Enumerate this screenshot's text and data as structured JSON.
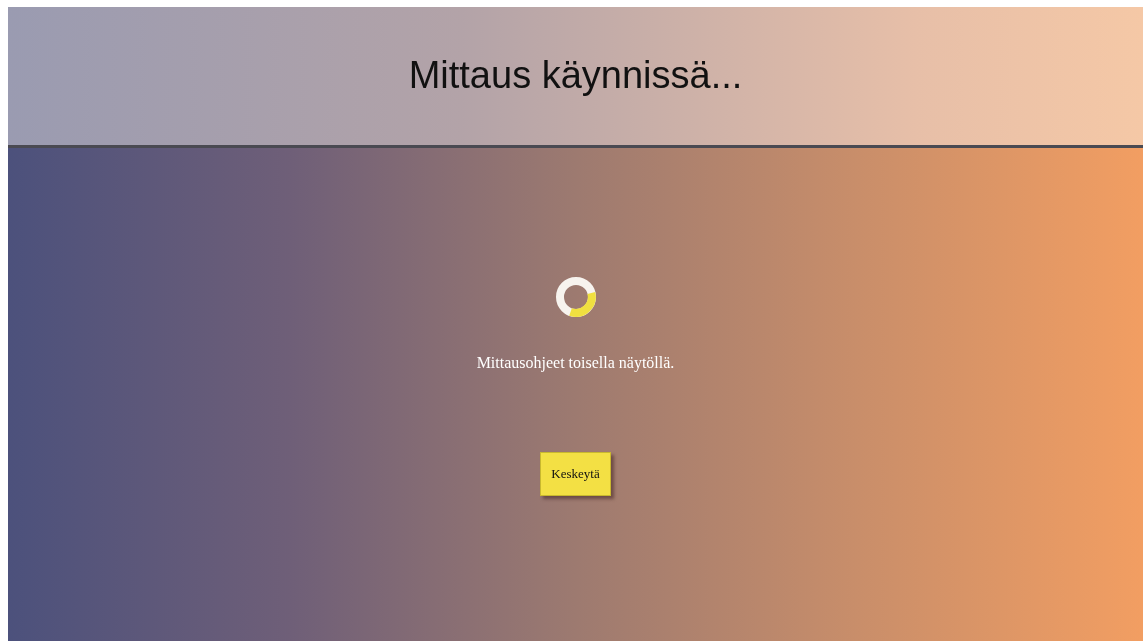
{
  "header": {
    "title": "Mittaus käynnissä..."
  },
  "main": {
    "message": "Mittausohjeet toisella näytöllä.",
    "buttons": [
      "Keskeytä"
    ]
  }
}
